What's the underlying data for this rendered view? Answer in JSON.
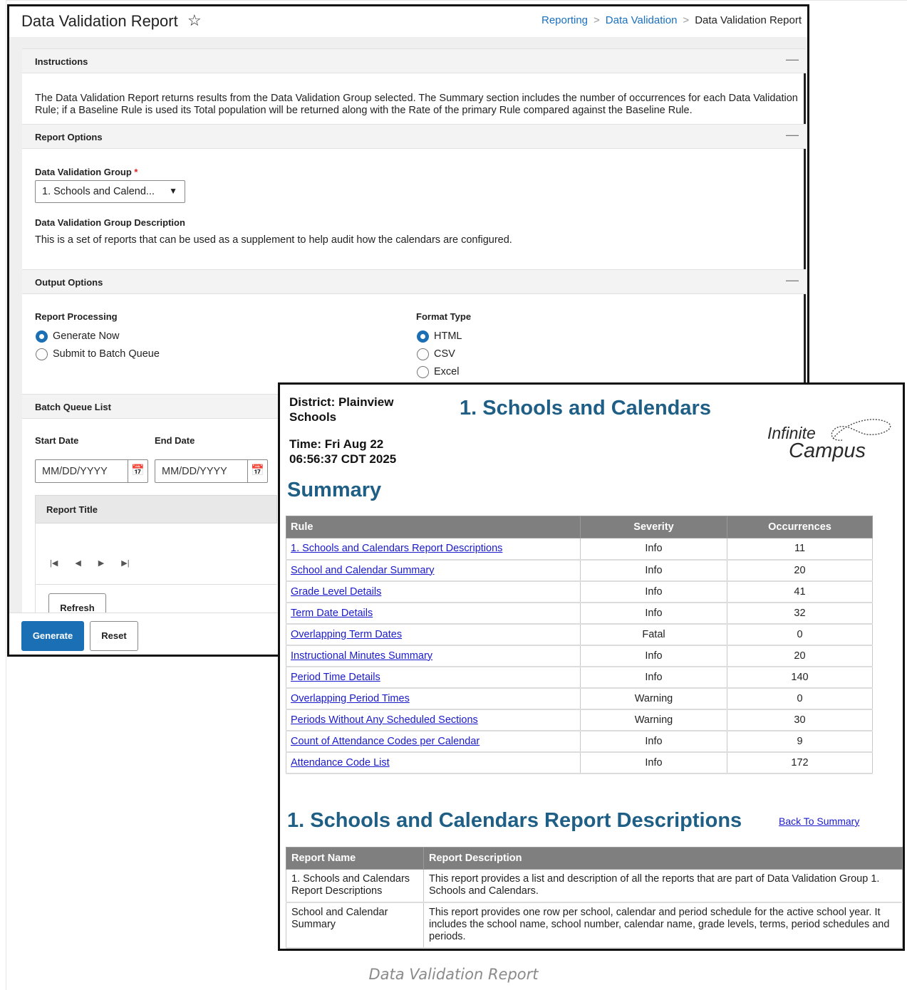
{
  "app": {
    "title": "Data Validation Report",
    "breadcrumb": [
      "Reporting",
      "Data Validation",
      "Data Validation Report"
    ]
  },
  "instructions": {
    "header": "Instructions",
    "text": "The Data Validation Report returns results from the Data Validation Group selected. The Summary section includes the number of occurrences for each Data Validation Rule; if a Baseline Rule is used its Total population will be returned along with the Rate of the primary Rule compared against the Baseline Rule."
  },
  "report_options": {
    "header": "Report Options",
    "group_label": "Data Validation Group",
    "required_mark": "*",
    "group_value": "1. Schools and Calend...",
    "description_label": "Data Validation Group Description",
    "description_text": "This is a set of reports that can be used as a supplement to help audit how the calendars are configured."
  },
  "output_options": {
    "header": "Output Options",
    "processing_label": "Report Processing",
    "processing_options": [
      "Generate Now",
      "Submit to Batch Queue"
    ],
    "processing_selected": "Generate Now",
    "format_label": "Format Type",
    "format_options": [
      "HTML",
      "CSV",
      "Excel"
    ],
    "format_selected": "HTML"
  },
  "batch_queue": {
    "header": "Batch Queue List",
    "start_label": "Start Date",
    "end_label": "End Date",
    "start_placeholder": "MM/DD/YYYY",
    "end_placeholder": "MM/DD/YYYY",
    "column_title": "Report Title",
    "refresh_label": "Refresh"
  },
  "footer": {
    "generate_label": "Generate",
    "reset_label": "Reset"
  },
  "report": {
    "district": "District: Plainview Schools",
    "time": "Time: Fri Aug 22 06:56:37 CDT 2025",
    "title": "1. Schools and Calendars",
    "logo_word1": "Infinite",
    "logo_word2": "Campus",
    "summary_heading": "Summary",
    "summary_columns": [
      "Rule",
      "Severity",
      "Occurrences"
    ],
    "summary_rows": [
      {
        "rule": "1. Schools and Calendars Report Descriptions",
        "severity": "Info",
        "occurrences": "11"
      },
      {
        "rule": "School and Calendar Summary",
        "severity": "Info",
        "occurrences": "20"
      },
      {
        "rule": "Grade Level Details",
        "severity": "Info",
        "occurrences": "41"
      },
      {
        "rule": "Term Date Details",
        "severity": "Info",
        "occurrences": "32"
      },
      {
        "rule": "Overlapping Term Dates",
        "severity": "Fatal",
        "occurrences": "0"
      },
      {
        "rule": "Instructional Minutes Summary",
        "severity": "Info",
        "occurrences": "20"
      },
      {
        "rule": "Period Time Details",
        "severity": "Info",
        "occurrences": "140"
      },
      {
        "rule": "Overlapping Period Times",
        "severity": "Warning",
        "occurrences": "0"
      },
      {
        "rule": "Periods Without Any Scheduled Sections",
        "severity": "Warning",
        "occurrences": "30"
      },
      {
        "rule": "Count of Attendance Codes per Calendar",
        "severity": "Info",
        "occurrences": "9"
      },
      {
        "rule": "Attendance Code List",
        "severity": "Info",
        "occurrences": "172"
      }
    ],
    "descriptions_heading": "1. Schools and Calendars Report Descriptions",
    "back_link": "Back To Summary",
    "desc_columns": [
      "Report Name",
      "Report Description"
    ],
    "desc_rows": [
      {
        "name": "1. Schools and Calendars Report Descriptions",
        "description": "This report provides a list and description of all the reports that are part of Data Validation Group 1. Schools and Calendars."
      },
      {
        "name": "School and Calendar Summary",
        "description": "This report provides one row per school, calendar and period schedule for the active school year. It includes the school name, school number, calendar name, grade levels, terms, period schedules and periods."
      }
    ]
  },
  "caption": "Data Validation Report",
  "colors": {
    "accent": "#1a6fb5",
    "report_heading": "#1f5f86",
    "link": "#1a1acc",
    "table_header": "#7f7f7f"
  }
}
